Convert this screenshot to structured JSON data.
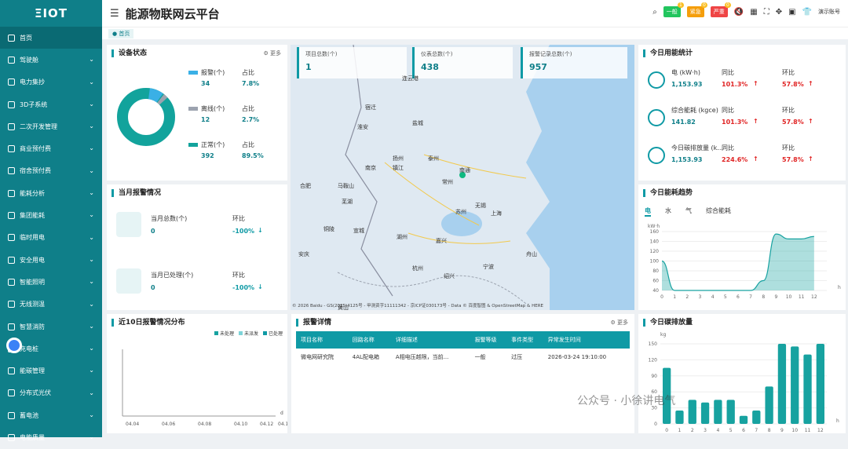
{
  "app": {
    "logo": "ΞIOT",
    "title": "能源物联网云平台",
    "user": "演示账号"
  },
  "alerts": {
    "general": {
      "label": "一般",
      "count": "1",
      "color": "#22c55e"
    },
    "urgent": {
      "label": "紧急",
      "count": "0",
      "color": "#f59e0b"
    },
    "severe": {
      "label": "严重",
      "count": "0",
      "color": "#ef4444"
    }
  },
  "tab": "首页",
  "sidebar": [
    {
      "label": "首页",
      "icon": "monitor-icon",
      "chev": false
    },
    {
      "label": "驾驶舱",
      "icon": "building-icon",
      "chev": true
    },
    {
      "label": "电力集抄",
      "icon": "meter-icon",
      "chev": true
    },
    {
      "label": "3D子系统",
      "icon": "cube-icon",
      "chev": true
    },
    {
      "label": "二次开发管理",
      "icon": "layers-icon",
      "chev": true
    },
    {
      "label": "商业预付费",
      "icon": "shop-icon",
      "chev": true
    },
    {
      "label": "宿舍预付费",
      "icon": "home-icon",
      "chev": true
    },
    {
      "label": "能耗分析",
      "icon": "chart-icon",
      "chev": true
    },
    {
      "label": "集团能耗",
      "icon": "group-icon",
      "chev": true
    },
    {
      "label": "临时用电",
      "icon": "plug-icon",
      "chev": true
    },
    {
      "label": "安全用电",
      "icon": "shield-icon",
      "chev": true
    },
    {
      "label": "智能照明",
      "icon": "bulb-icon",
      "chev": true
    },
    {
      "label": "无线测温",
      "icon": "thermo-icon",
      "chev": true
    },
    {
      "label": "智慧消防",
      "icon": "fire-icon",
      "chev": true
    },
    {
      "label": "充电桩",
      "icon": "charger-icon",
      "chev": true
    },
    {
      "label": "能碳管理",
      "icon": "leaf-icon",
      "chev": true
    },
    {
      "label": "分布式光伏",
      "icon": "solar-icon",
      "chev": true
    },
    {
      "label": "蓄电池",
      "icon": "battery-icon",
      "chev": true
    },
    {
      "label": "电能质量",
      "icon": "wave-icon",
      "chev": true
    }
  ],
  "device_status": {
    "title": "设备状态",
    "more": "更多",
    "items": [
      {
        "label": "报警(个)",
        "value": "34",
        "ratio_label": "占比",
        "ratio": "7.8%",
        "color": "#3ab0e6"
      },
      {
        "label": "离线(个)",
        "value": "12",
        "ratio_label": "占比",
        "ratio": "2.7%",
        "color": "#9ca3af"
      },
      {
        "label": "正常(个)",
        "value": "392",
        "ratio_label": "占比",
        "ratio": "89.5%",
        "color": "#12a39c"
      }
    ]
  },
  "map": {
    "stats": [
      {
        "label": "项目总数(个)",
        "value": "1"
      },
      {
        "label": "仪表总数(个)",
        "value": "438"
      },
      {
        "label": "报警记录总数(个)",
        "value": "957"
      }
    ],
    "cities": [
      "连云港",
      "宿迁",
      "淮安",
      "盐城",
      "泰州",
      "扬州",
      "南京",
      "镇江",
      "常州",
      "南通",
      "合肥",
      "马鞍山",
      "芜湖",
      "苏州",
      "无锡",
      "上海",
      "铜陵",
      "宣城",
      "湖州",
      "嘉兴",
      "杭州",
      "绍兴",
      "宁波",
      "安庆",
      "黄山",
      "舟山"
    ],
    "copyright": "© 2026 Baidu - GS(2025)4125号 - 甲测资字11111342 - 京ICP证030173号 - Data © 百度智图 & OpenStreetMap & HERE"
  },
  "monthly_alarm": {
    "title": "当月报警情况",
    "items": [
      {
        "label": "当月总数(个)",
        "value": "0",
        "ratio_label": "环比",
        "ratio": "-100%"
      },
      {
        "label": "当月已处理(个)",
        "value": "0",
        "ratio_label": "环比",
        "ratio": "-100%"
      }
    ]
  },
  "today_energy": {
    "title": "今日用能统计",
    "items": [
      {
        "label": "电 (kW·h)",
        "value": "1,153.93",
        "yoy_label": "同比",
        "yoy": "101.3%",
        "mom_label": "环比",
        "mom": "57.8%"
      },
      {
        "label": "综合能耗 (kgce)",
        "value": "141.82",
        "yoy_label": "同比",
        "yoy": "101.3%",
        "mom_label": "环比",
        "mom": "57.8%"
      },
      {
        "label": "今日碳排放量 (k...",
        "value": "1,153.93",
        "yoy_label": "同比",
        "yoy": "224.6%",
        "mom_label": "环比",
        "mom": "57.8%"
      }
    ]
  },
  "trend": {
    "title": "今日能耗趋势",
    "tabs": [
      "电",
      "水",
      "气",
      "综合能耗"
    ]
  },
  "alarm10": {
    "title": "近10日报警情况分布",
    "legend": [
      "未处理",
      "未派发",
      "已处理"
    ],
    "legend_colors": [
      "#17a2a0",
      "#7dd3d8",
      "#0f9aa5"
    ]
  },
  "alarm_detail": {
    "title": "报警详情",
    "more": "更多",
    "columns": [
      "项目名称",
      "回路名称",
      "详细描述",
      "报警等级",
      "事件类型",
      "异常发生时间"
    ],
    "rows": [
      [
        "微电网研究院",
        "4AL配电箱",
        "A相电压越限，当前...",
        "一般",
        "过压",
        "2026-03-24 19:10:00"
      ]
    ]
  },
  "carbon": {
    "title": "今日碳排放量"
  },
  "watermark": "公众号 · 小徐讲电气",
  "chart_data": [
    {
      "type": "area",
      "title": "",
      "xlabel": "h",
      "ylabel": "kW·h",
      "x": [
        0,
        1,
        2,
        3,
        4,
        5,
        6,
        7,
        8,
        9,
        10,
        11,
        12
      ],
      "values": [
        100,
        15,
        5,
        40,
        40,
        40,
        40,
        40,
        60,
        155,
        145,
        145,
        150
      ],
      "ylim": [
        40,
        160
      ],
      "yticks": [
        40,
        60,
        80,
        100,
        120,
        140,
        160
      ],
      "xlim": [
        0,
        13
      ]
    },
    {
      "type": "bar",
      "title": "",
      "xlabel": "h",
      "ylabel": "kg",
      "x": [
        0,
        1,
        2,
        3,
        4,
        5,
        6,
        7,
        8,
        9,
        10,
        11,
        12
      ],
      "values": [
        105,
        25,
        45,
        40,
        45,
        45,
        15,
        25,
        70,
        155,
        145,
        130,
        150
      ],
      "ylim": [
        0,
        150
      ],
      "yticks": [
        0,
        30,
        60,
        90,
        120,
        150
      ]
    },
    {
      "type": "line",
      "title": "",
      "xlabel": "d",
      "categories": [
        "04.04",
        "04.06",
        "04.08",
        "04.10",
        "04.12",
        "04.13"
      ],
      "values": [
        0,
        0,
        0,
        0,
        0,
        0
      ]
    }
  ]
}
